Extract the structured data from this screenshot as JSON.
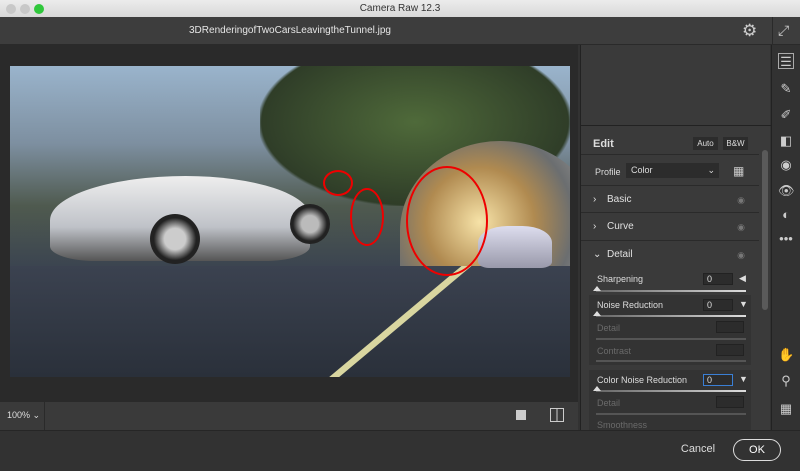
{
  "window": {
    "title": "Camera Raw 12.3",
    "traffic_lights": [
      "#c8c8c8",
      "#c8c8c8",
      "#2fc73b"
    ]
  },
  "header": {
    "filename": "3DRenderingofTwoCarsLeavingtheTunnel.jpg",
    "settings_icon": "gear-icon",
    "fullscreen_icon": "expand-icon"
  },
  "edit": {
    "title": "Edit",
    "auto_label": "Auto",
    "bw_label": "B&W",
    "profile_label": "Profile",
    "profile_value": "Color",
    "profile_browser_icon": "grid-search-icon"
  },
  "sections": [
    {
      "label": "Basic",
      "expanded": false
    },
    {
      "label": "Curve",
      "expanded": false
    },
    {
      "label": "Detail",
      "expanded": true
    }
  ],
  "detail": {
    "sharpening": {
      "label": "Sharpening",
      "value": "0"
    },
    "noise_reduction": {
      "label": "Noise Reduction",
      "value": "0",
      "detail_label": "Detail",
      "contrast_label": "Contrast"
    },
    "color_noise_reduction": {
      "label": "Color Noise Reduction",
      "value": "0",
      "detail_label": "Detail",
      "smoothness_label": "Smoothness"
    }
  },
  "bottom": {
    "zoom": "100%"
  },
  "footer": {
    "cancel_label": "Cancel",
    "ok_label": "OK"
  },
  "annotation_color": "#e00000"
}
